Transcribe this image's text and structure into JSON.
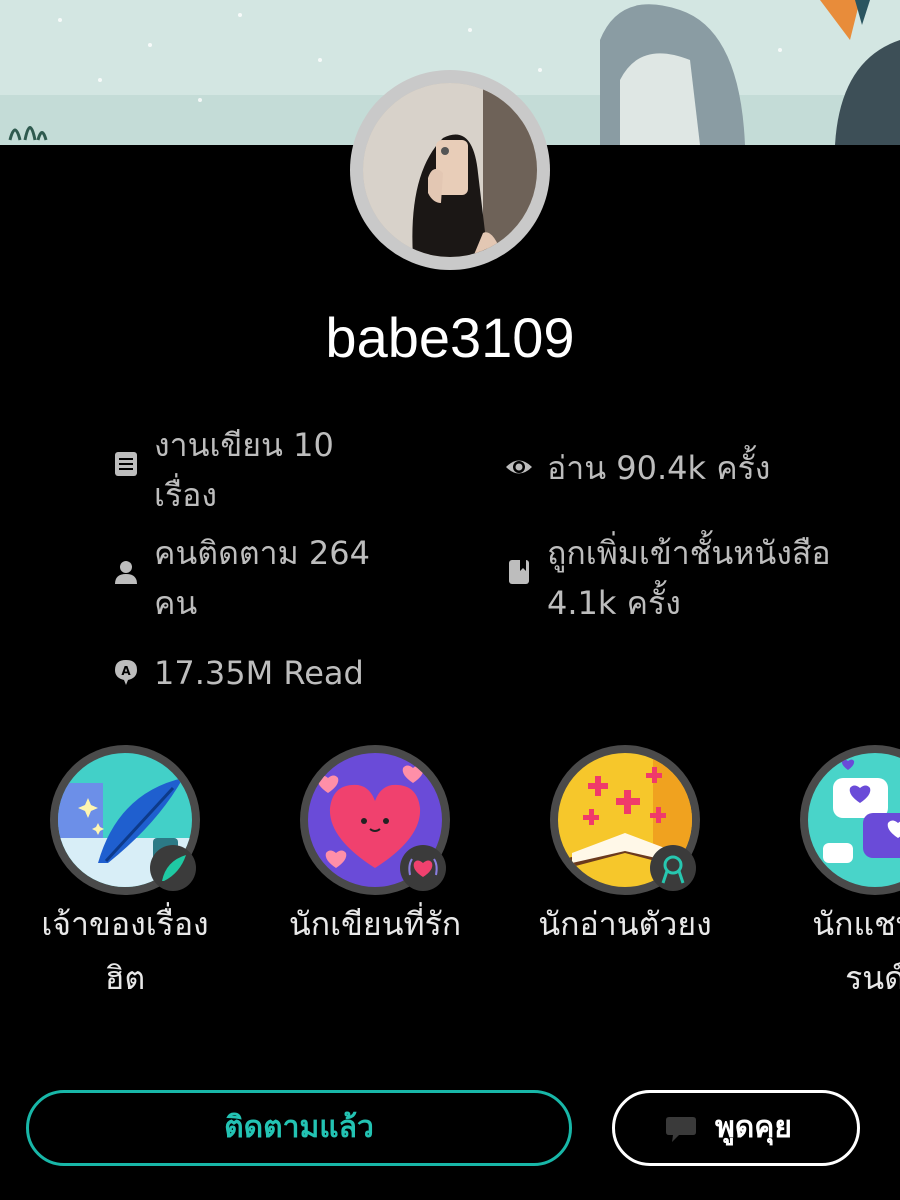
{
  "profile": {
    "username": "babe3109"
  },
  "stats": {
    "stories": "งานเขียน 10\nเรื่อง",
    "reads": "อ่าน 90.4k ครั้ง",
    "followers": "คนติดตาม 264\nคน",
    "library": "ถูกเพิ่มเข้าชั้นหนังสือ\n4.1k ครั้ง",
    "total_reads": "17.35M Read"
  },
  "badges": [
    {
      "label": "เจ้าของเรื่อง\nฮิต",
      "icon": "quill-badge-icon"
    },
    {
      "label": "นักเขียนที่รัก",
      "icon": "heart-badge-icon"
    },
    {
      "label": "นักอ่านตัวยง",
      "icon": "book-badge-icon"
    },
    {
      "label": "นักแชทตั\nรนด์",
      "icon": "chat-badge-icon"
    }
  ],
  "actions": {
    "follow_label": "ติดตามแล้ว",
    "chat_label": "พูดคุย"
  },
  "colors": {
    "accent": "#18b7a8",
    "background": "#000000",
    "stat_text": "#bdbdbd"
  }
}
